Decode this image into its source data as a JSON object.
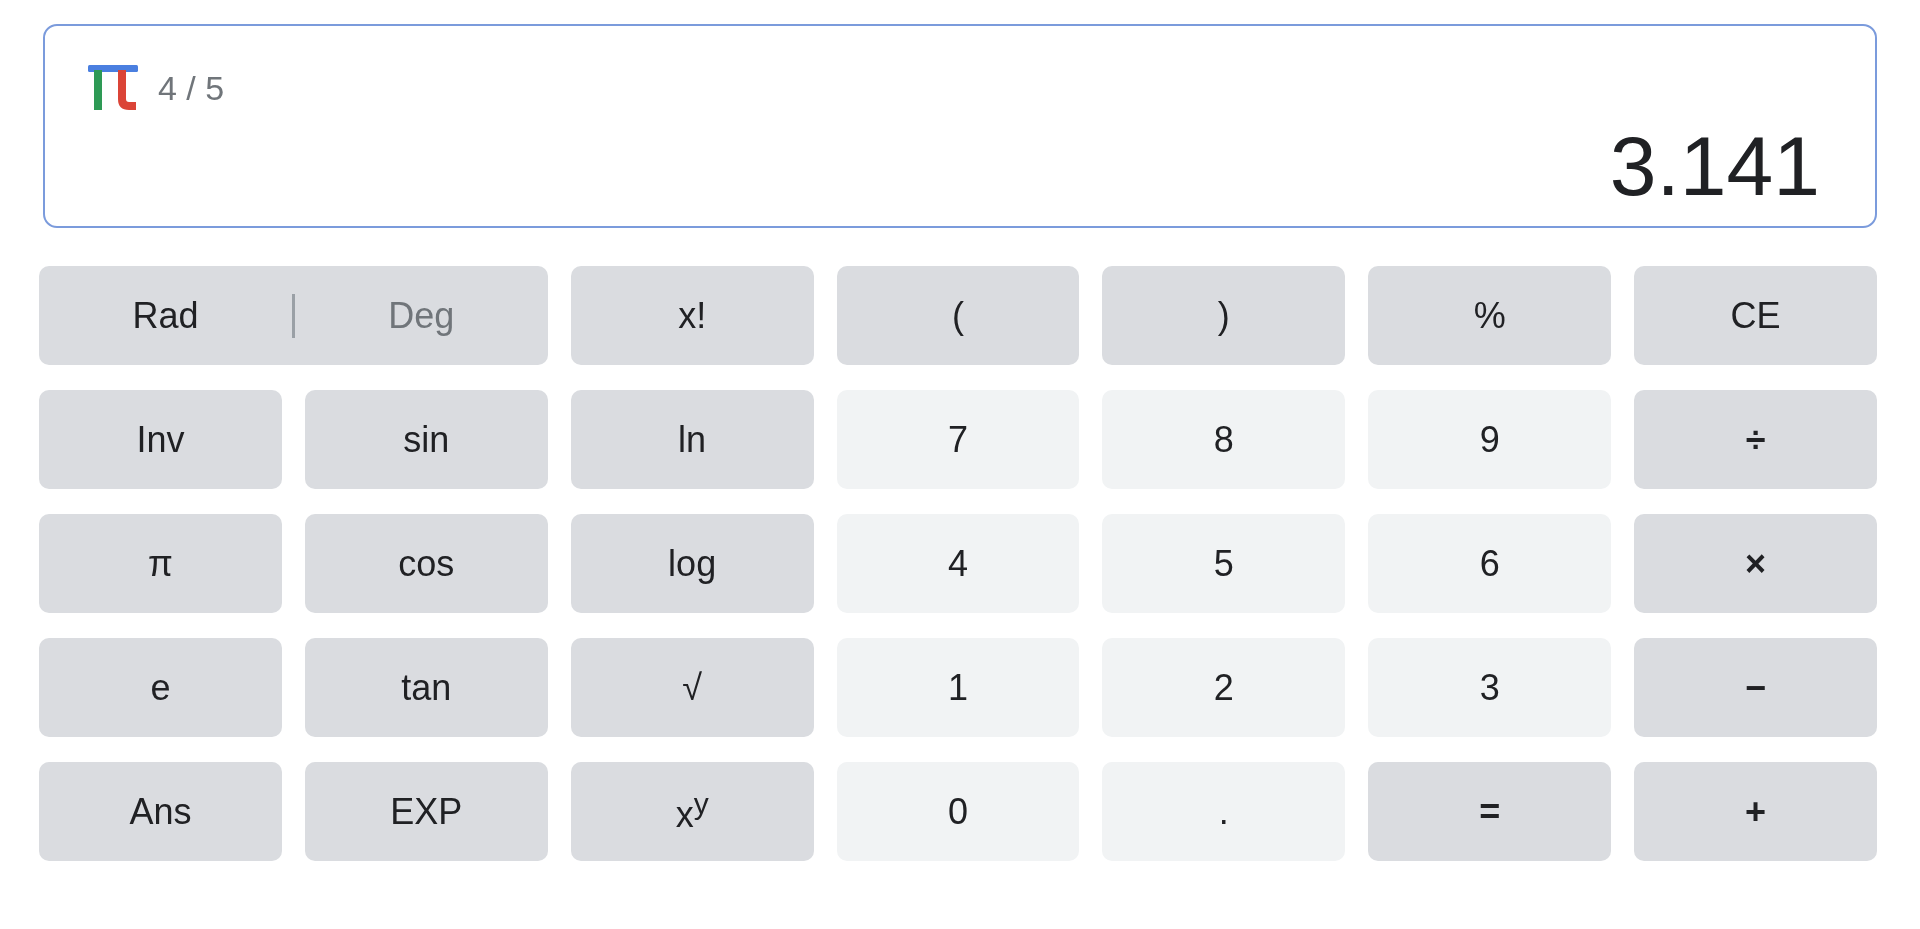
{
  "display": {
    "counter": "4 / 5",
    "value": "3.141"
  },
  "angle_toggle": [
    {
      "label": "Rad",
      "selected": true
    },
    {
      "label": "Deg",
      "selected": false
    }
  ],
  "keys": [
    {
      "label": "x!",
      "kind": "function"
    },
    {
      "label": "(",
      "kind": "function"
    },
    {
      "label": ")",
      "kind": "function"
    },
    {
      "label": "%",
      "kind": "function"
    },
    {
      "label": "CE",
      "kind": "function"
    },
    {
      "label": "Inv",
      "kind": "function"
    },
    {
      "label": "sin",
      "kind": "function"
    },
    {
      "label": "ln",
      "kind": "function"
    },
    {
      "label": "7",
      "kind": "digit"
    },
    {
      "label": "8",
      "kind": "digit"
    },
    {
      "label": "9",
      "kind": "digit"
    },
    {
      "label": "÷",
      "kind": "operator"
    },
    {
      "label": "π",
      "kind": "function"
    },
    {
      "label": "cos",
      "kind": "function"
    },
    {
      "label": "log",
      "kind": "function"
    },
    {
      "label": "4",
      "kind": "digit"
    },
    {
      "label": "5",
      "kind": "digit"
    },
    {
      "label": "6",
      "kind": "digit"
    },
    {
      "label": "×",
      "kind": "operator"
    },
    {
      "label": "e",
      "kind": "function"
    },
    {
      "label": "tan",
      "kind": "function"
    },
    {
      "label": "√",
      "kind": "function"
    },
    {
      "label": "1",
      "kind": "digit"
    },
    {
      "label": "2",
      "kind": "digit"
    },
    {
      "label": "3",
      "kind": "digit"
    },
    {
      "label": "−",
      "kind": "operator"
    },
    {
      "label": "Ans",
      "kind": "function"
    },
    {
      "label": "EXP",
      "kind": "function"
    },
    {
      "label": "x$^{y}$",
      "kind": "function"
    },
    {
      "label": "0",
      "kind": "digit"
    },
    {
      "label": ".",
      "kind": "digit"
    },
    {
      "label": "=",
      "kind": "operator"
    },
    {
      "label": "+",
      "kind": "operator"
    }
  ]
}
